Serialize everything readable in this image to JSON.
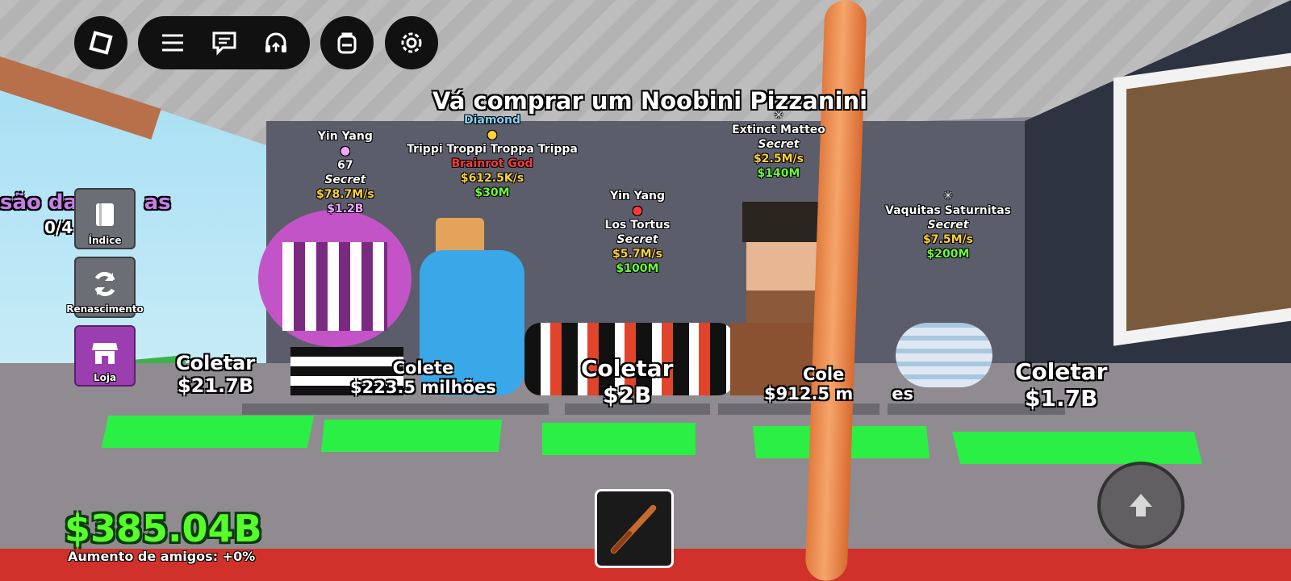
{
  "topbar": {
    "roblox_menu": "roblox-menu-icon",
    "hamburger": "hamburger-icon",
    "chat": "chat-icon",
    "headset": "headset-icon",
    "backpack": "backpack-icon",
    "settings": "gear-icon"
  },
  "objective": "Vá comprar um Noobini Pizzanini",
  "sidebar": {
    "partial_title": "são das",
    "partial_title_right": "as",
    "progress": "0/4",
    "items": [
      {
        "label": "Índice",
        "icon": "book-icon",
        "color": "#6b6e74"
      },
      {
        "label": "Renascimento",
        "icon": "refresh-icon",
        "color": "#6b6e74"
      },
      {
        "label": "Loja",
        "icon": "shop-icon",
        "color": "#9b3fb0"
      }
    ]
  },
  "pets": [
    {
      "name": "Yin Yang",
      "extra": "67",
      "rarity": "Secret",
      "rate": "$78.7M/s",
      "price": "$1.2B"
    },
    {
      "mutation": "Diamond",
      "name": "Trippi Troppi Troppa Trippa",
      "rarity": "Brainrot God",
      "rate": "$612.5K/s",
      "price": "$30M"
    },
    {
      "name": "Yin Yang",
      "name2": "Los Tortus",
      "rarity": "Secret",
      "rate": "$5.7M/s",
      "price": "$100M"
    },
    {
      "name": "Extinct Matteo",
      "rarity": "Secret",
      "rate": "$2.5M/s",
      "price": "$140M"
    },
    {
      "name": "Vaquitas Saturnitas",
      "rarity": "Secret",
      "rate": "$7.5M/s",
      "price": "$200M"
    }
  ],
  "collect": [
    {
      "label": "Coletar",
      "amount": "$21.7B"
    },
    {
      "label": "Colete",
      "amount": "$223.5 milhões"
    },
    {
      "label": "Coletar",
      "amount": "$2B"
    },
    {
      "label": "Cole",
      "amount": "$912.5 m",
      "amount_tail": "es"
    },
    {
      "label": "Coletar",
      "amount": "$1.7B"
    }
  ],
  "hud": {
    "money": "$385.04B",
    "friends_boost": "Aumento de amigos: +0%",
    "hotbar_item": "bat-icon",
    "jump": "jump-arrow-icon"
  },
  "colors": {
    "money": "#57ff2a",
    "pad": "#2bef45",
    "price": "#6bff3a",
    "rate": "#ffd23a",
    "shop": "#9b3fb0"
  }
}
